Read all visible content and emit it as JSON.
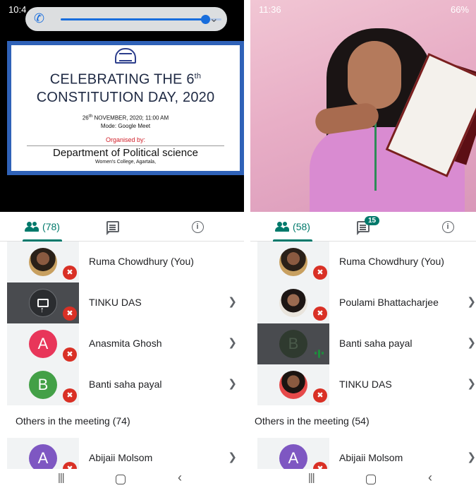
{
  "left": {
    "status_time": "10:4",
    "volume_level": 0.9,
    "slide": {
      "title_line1": "CELEBRATING THE 6",
      "title_sup": "th",
      "title_line2": "CONSTITUTION DAY, 2020",
      "date_day": "26",
      "date_sup": "th",
      "date_rest": " NOVEMBER, 2020;  11:00 AM",
      "mode": "Mode: Google Meet",
      "organised_label": "Organised by:",
      "department": "Department of Political science",
      "college": "Women's College, Agartala,"
    },
    "tabs": {
      "people_count": "(78)"
    },
    "participants": [
      {
        "name": "Ruma Chowdhury (You)",
        "avatar": "photo",
        "muted": true,
        "chevron": false
      },
      {
        "name": "TINKU DAS",
        "avatar": "screen-share",
        "muted": true,
        "chevron": true
      },
      {
        "name": "Anasmita Ghosh",
        "avatar_letter": "A",
        "avatar_color": "#e8365a",
        "muted": true,
        "chevron": true
      },
      {
        "name": "Banti saha payal",
        "avatar_letter": "B",
        "avatar_color": "#43a047",
        "muted": true,
        "chevron": true
      }
    ],
    "others_label": "Others in the meeting (74)",
    "others": [
      {
        "name": "Abijaii Molsom",
        "avatar_letter": "A",
        "avatar_color": "#7e57c2"
      }
    ]
  },
  "right": {
    "status_time": "11:36",
    "status_right": "66%",
    "tabs": {
      "people_count": "(58)",
      "chat_badge": "15"
    },
    "participants": [
      {
        "name": "Ruma Chowdhury (You)",
        "avatar": "photo",
        "muted": true,
        "chevron": false
      },
      {
        "name": "Poulami Bhattacharjee",
        "avatar": "photo",
        "muted": true,
        "chevron": true
      },
      {
        "name": "Banti saha payal",
        "avatar_letter": "B",
        "speaking": true,
        "chevron": true
      },
      {
        "name": "TINKU DAS",
        "avatar": "photo",
        "muted": true,
        "chevron": true
      }
    ],
    "others_label": "Others in the meeting (54)",
    "others": [
      {
        "name": "Abijaii Molsom",
        "avatar_letter": "A",
        "avatar_color": "#7e57c2"
      }
    ]
  },
  "icons": {
    "people": "people-icon",
    "chat": "chat-icon",
    "info": "info-icon",
    "mute": "mic-off-icon",
    "chevron": "chevron-right-icon",
    "screen_share": "present-screen-icon",
    "nav": [
      "recent-apps-icon",
      "home-icon",
      "back-icon"
    ]
  },
  "colors": {
    "accent": "#00796b",
    "muted_badge": "#d93025",
    "speaking": "#1e8e3e"
  }
}
